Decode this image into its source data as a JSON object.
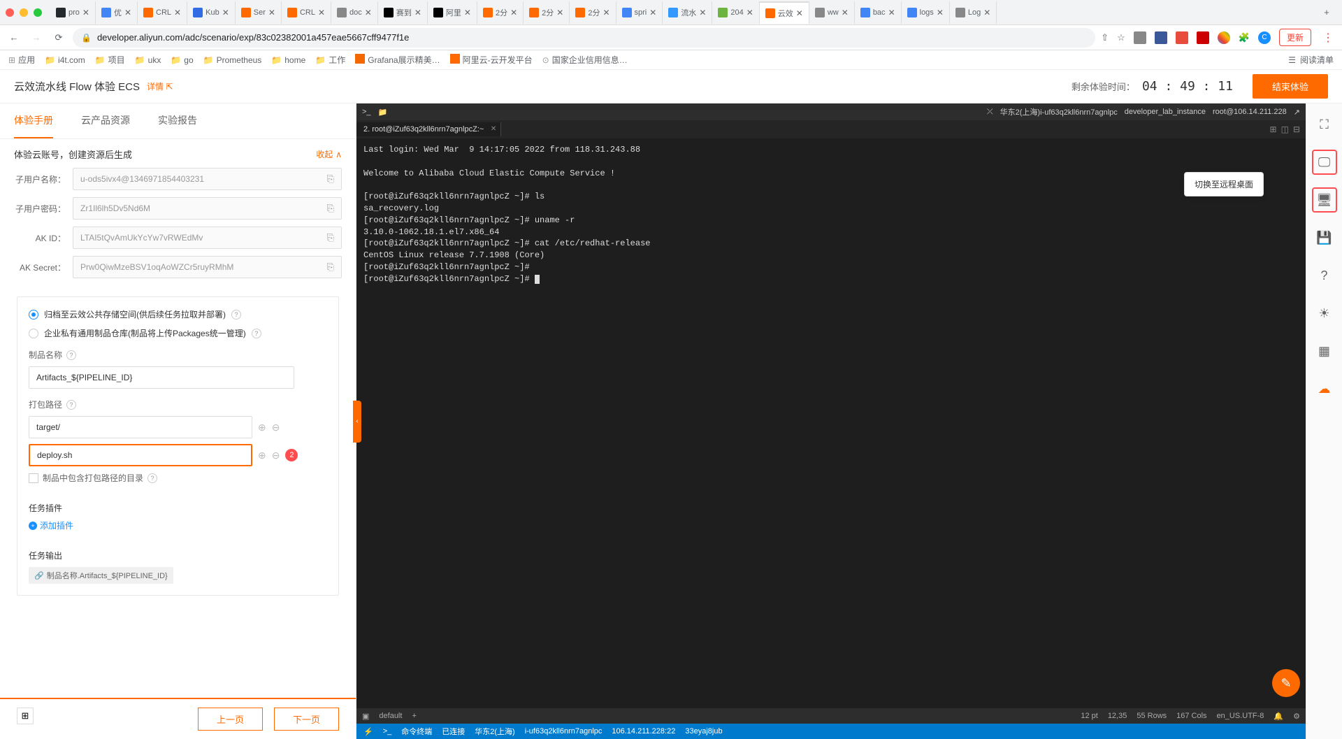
{
  "browser": {
    "tabs": [
      {
        "icon": "#24292e",
        "label": "pro"
      },
      {
        "icon": "#4285f4",
        "label": "优"
      },
      {
        "icon": "#ff6a00",
        "label": "CRL"
      },
      {
        "icon": "#326ce5",
        "label": "Kub"
      },
      {
        "icon": "#ff6a00",
        "label": "Ser"
      },
      {
        "icon": "#ff6a00",
        "label": "CRL"
      },
      {
        "icon": "#888",
        "label": "doc"
      },
      {
        "icon": "#000",
        "label": "赛到"
      },
      {
        "icon": "#000",
        "label": "阿里"
      },
      {
        "icon": "#ff6a00",
        "label": "2分"
      },
      {
        "icon": "#ff6a00",
        "label": "2分"
      },
      {
        "icon": "#ff6a00",
        "label": "2分"
      },
      {
        "icon": "#4285f4",
        "label": "spri"
      },
      {
        "icon": "#3399ff",
        "label": "流水"
      },
      {
        "icon": "#6db33f",
        "label": "204"
      },
      {
        "icon": "#ff6a00",
        "label": "云效",
        "active": true
      },
      {
        "icon": "#888",
        "label": "ww"
      },
      {
        "icon": "#4285f4",
        "label": "bac"
      },
      {
        "icon": "#4285f4",
        "label": "logs"
      },
      {
        "icon": "#888",
        "label": "Log"
      }
    ],
    "url": "developer.aliyun.com/adc/scenario/exp/83c02382001a457eae5667cff9477f1e",
    "update_btn": "更新",
    "bookmarks": [
      {
        "icon": "apps",
        "label": "应用"
      },
      {
        "icon": "folder",
        "label": "i4t.com"
      },
      {
        "icon": "folder",
        "label": "项目"
      },
      {
        "icon": "folder",
        "label": "ukx"
      },
      {
        "icon": "folder",
        "label": "go"
      },
      {
        "icon": "folder",
        "label": "Prometheus"
      },
      {
        "icon": "folder",
        "label": "home"
      },
      {
        "icon": "folder",
        "label": "工作"
      },
      {
        "icon": "grafana",
        "label": "Grafana展示精美…"
      },
      {
        "icon": "aliyun",
        "label": "阿里云-云开发平台"
      },
      {
        "icon": "gov",
        "label": "国家企业信用信息…"
      }
    ],
    "reading_list": "阅读清单"
  },
  "header": {
    "title": "云效流水线 Flow 体验 ECS",
    "detail": "详情",
    "timer_label": "剩余体验时间：",
    "timer_value": "04 : 49 : 11",
    "end_btn": "结束体验"
  },
  "left": {
    "tabs": [
      "体验手册",
      "云产品资源",
      "实验报告"
    ],
    "cred_title": "体验云账号，创建资源后生成",
    "collapse": "收起",
    "fields": [
      {
        "label": "子用户名称：",
        "value": "u-ods5ivx4@1346971854403231"
      },
      {
        "label": "子用户密码：",
        "value": "Zr1Il6lh5Dv5Nd6M"
      },
      {
        "label": "AK ID：",
        "value": "LTAI5tQvAmUkYcYw7vRWEdMv"
      },
      {
        "label": "AK Secret：",
        "value": "Prw0QiwMzeBSV1oqAoWZCr5ruyRMhM"
      }
    ],
    "radio1": "归档至云效公共存储空间(供后续任务拉取并部署)",
    "radio2": "企业私有通用制品仓库(制品将上传Packages统一管理)",
    "artifact_label": "制品名称",
    "artifact_value": "Artifacts_${PIPELINE_ID}",
    "path_label": "打包路径",
    "path1": "target/",
    "path2": "deploy.sh",
    "badge": "2",
    "checkbox_label": "制品中包含打包路径的目录",
    "plugin_label": "任务插件",
    "add_plugin": "添加插件",
    "output_label": "任务输出",
    "output_chip": "制品名称.Artifacts_${PIPELINE_ID}",
    "prev": "上一页",
    "next": "下一页"
  },
  "terminal": {
    "titlebar": {
      "region": "华东2(上海)i-uf63q2kll6nrn7agnlpc",
      "instance": "developer_lab_instance",
      "root": "root@106.14.211.228"
    },
    "tab": "2. root@iZuf63q2kll6nrn7agnlpcZ:~",
    "lines": [
      "Last login: Wed Mar  9 14:17:05 2022 from 118.31.243.88",
      "",
      "Welcome to Alibaba Cloud Elastic Compute Service !",
      "",
      "[root@iZuf63q2kll6nrn7agnlpcZ ~]# ls",
      "sa_recovery.log",
      "[root@iZuf63q2kll6nrn7agnlpcZ ~]# uname -r",
      "3.10.0-1062.18.1.el7.x86_64",
      "[root@iZuf63q2kll6nrn7agnlpcZ ~]# cat /etc/redhat-release",
      "CentOS Linux release 7.7.1908 (Core)",
      "[root@iZuf63q2kll6nrn7agnlpcZ ~]#",
      "[root@iZuf63q2kll6nrn7agnlpcZ ~]# "
    ],
    "status": {
      "tab": "default",
      "pt": "12 pt",
      "pos": "12,35",
      "rows": "55 Rows",
      "cols": "167 Cols",
      "enc": "en_US.UTF-8"
    },
    "bottom": {
      "cmd": "命令终端",
      "conn": "已连接",
      "region": "华东2(上海)",
      "inst": "i-uf63q2kll6nrn7agnlpc",
      "ip": "106.14.211.228:22",
      "sess": "33eyaj8jub"
    }
  },
  "tooltip": "切换至远程桌面"
}
